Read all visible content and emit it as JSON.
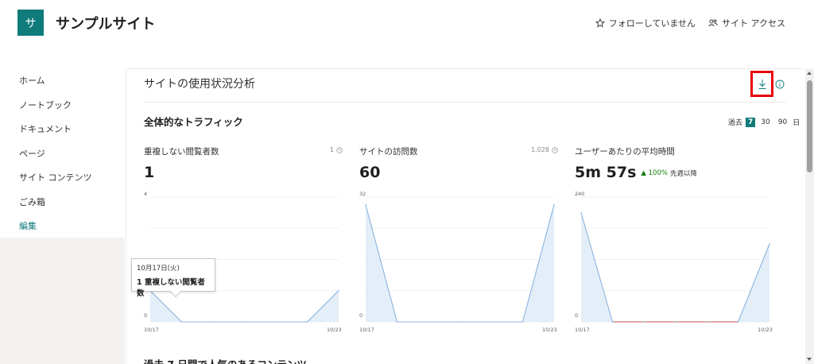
{
  "header": {
    "logo_letter": "サ",
    "site_title": "サンプルサイト",
    "follow_label": "フォローしていません",
    "site_access_label": "サイト アクセス"
  },
  "nav": {
    "items": [
      {
        "label": "ホーム"
      },
      {
        "label": "ノートブック"
      },
      {
        "label": "ドキュメント"
      },
      {
        "label": "ページ"
      },
      {
        "label": "サイト コンテンツ"
      },
      {
        "label": "ごみ箱"
      },
      {
        "label": "編集"
      }
    ]
  },
  "main": {
    "page_title": "サイトの使用状況分析",
    "section_title": "全体的なトラフィック",
    "range": {
      "prefix": "過去",
      "options": [
        "7",
        "30",
        "90"
      ],
      "selected": "7",
      "suffix": "日"
    },
    "next_section_title": "過去 7 日間で人気のあるコンテンツ"
  },
  "cards": [
    {
      "label": "重複しない閲覧者数",
      "meta": "1",
      "value": "1"
    },
    {
      "label": "サイトの訪問数",
      "meta": "1,028",
      "value": "60"
    },
    {
      "label": "ユーザーあたりの平均時間",
      "meta": "",
      "value": "5m 57s",
      "delta": "▲ 100%",
      "delta_label": "先週以降"
    }
  ],
  "tooltip": {
    "date": "10月17日(火)",
    "text": "1 重複しない閲覧者数"
  },
  "colors": {
    "accent": "#0f7b7b",
    "line": "#8ab4e0",
    "fill": "#deebf7",
    "highlight": "#e8000b",
    "positive": "#107c10",
    "flat_line": "#c0504d"
  },
  "chart_data": [
    {
      "type": "area",
      "title": "重複しない閲覧者数",
      "x": [
        "10/17",
        "10/18",
        "10/19",
        "10/20",
        "10/21",
        "10/22",
        "10/23"
      ],
      "x_tick_labels": [
        "10/17",
        "10/23"
      ],
      "values": [
        1,
        0,
        0,
        0,
        0,
        0,
        1
      ],
      "ylim": [
        0,
        4
      ],
      "y_tick_labels": [
        "4",
        "0"
      ],
      "grid": true
    },
    {
      "type": "area",
      "title": "サイトの訪問数",
      "x": [
        "10/17",
        "10/18",
        "10/19",
        "10/20",
        "10/21",
        "10/22",
        "10/23"
      ],
      "x_tick_labels": [
        "10/17",
        "10/23"
      ],
      "values": [
        30,
        0,
        0,
        0,
        0,
        0,
        30
      ],
      "ylim": [
        0,
        32
      ],
      "y_tick_labels": [
        "32",
        "0"
      ],
      "grid": true
    },
    {
      "type": "area",
      "title": "ユーザーあたりの平均時間",
      "x": [
        "10/17",
        "10/18",
        "10/19",
        "10/20",
        "10/21",
        "10/22",
        "10/23"
      ],
      "x_tick_labels": [
        "10/17",
        "10/23"
      ],
      "values": [
        210,
        0,
        0,
        0,
        0,
        0,
        150
      ],
      "ylim": [
        0,
        240
      ],
      "y_tick_labels": [
        "240",
        "0"
      ],
      "grid": true
    }
  ]
}
